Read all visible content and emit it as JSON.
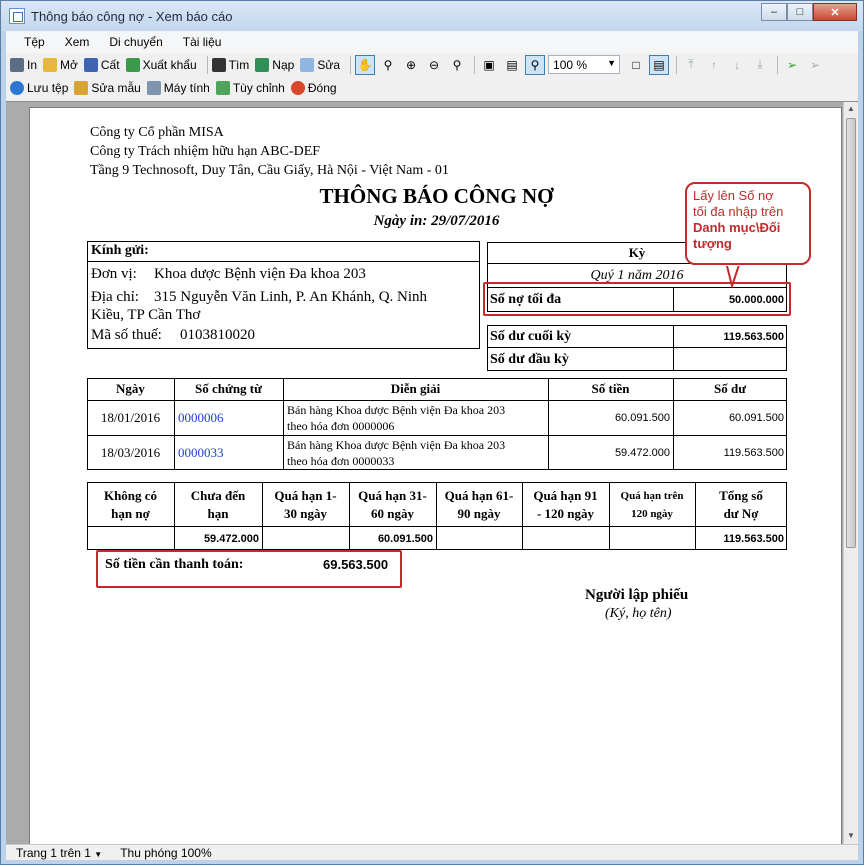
{
  "window": {
    "title": "Thông báo công nợ - Xem báo cáo"
  },
  "menu": [
    "Tệp",
    "Xem",
    "Di chuyển",
    "Tài liệu"
  ],
  "toolbar1": {
    "print": "In",
    "open": "Mở",
    "save": "Cất",
    "export": "Xuất khẩu",
    "find": "Tìm",
    "load": "Nạp",
    "edit": "Sửa",
    "zoom": "100 %"
  },
  "toolbar2": {
    "save_file": "Lưu tệp",
    "edit_template": "Sửa mẫu",
    "calculator": "Máy tính",
    "customize": "Tùy chỉnh",
    "close": "Đóng"
  },
  "status": {
    "page": "Trang 1 trên 1",
    "zoom": "Thu phóng 100%"
  },
  "report": {
    "company1": "Công ty Cổ phần MISA",
    "company2": "Công ty Trách nhiệm hữu hạn ABC-DEF",
    "address": "Tầng 9 Technosoft, Duy Tân, Cầu Giấy, Hà Nội - Việt Nam - 01",
    "title": "THÔNG BÁO CÔNG NỢ",
    "print_date": "Ngày in: 29/07/2016",
    "recipient": {
      "heading": "Kính gửi:",
      "unit_label": "Đơn vị:",
      "unit": "Khoa dược Bệnh viện Đa khoa 203",
      "address_label": "Địa chỉ:",
      "address_line1": "315 Nguyễn Văn Linh, P. An Khánh, Q. Ninh",
      "address_line2": "Kiều, TP Cần Thơ",
      "tax_label": "Mã số thuế:",
      "tax": "0103810020"
    },
    "period": {
      "heading": "Kỳ",
      "value": "Quý 1 năm 2016",
      "max_debt_label": "Số nợ tối đa",
      "max_debt": "50.000.000",
      "closing_label": "Số dư cuối kỳ",
      "closing": "119.563.500",
      "opening_label": "Số dư đầu kỳ",
      "opening": ""
    },
    "detail": {
      "headers": [
        "Ngày",
        "Số chứng từ",
        "Diễn giải",
        "Số tiền",
        "Số dư"
      ],
      "rows": [
        {
          "date": "18/01/2016",
          "doc": "0000006",
          "desc1": "Bán hàng Khoa dược Bệnh viện Đa khoa 203",
          "desc2": "theo hóa đơn 0000006",
          "amount": "60.091.500",
          "balance": "60.091.500"
        },
        {
          "date": "18/03/2016",
          "doc": "0000033",
          "desc1": "Bán hàng Khoa dược Bệnh viện Đa khoa 203",
          "desc2": "theo hóa đơn 0000033",
          "amount": "59.472.000",
          "balance": "119.563.500"
        }
      ]
    },
    "aging": {
      "headers": [
        [
          "Không có",
          "hạn nợ"
        ],
        [
          "Chưa đến",
          "hạn"
        ],
        [
          "Quá hạn 1-",
          "30 ngày"
        ],
        [
          "Quá hạn 31-",
          "60 ngày"
        ],
        [
          "Quá hạn 61-",
          "90 ngày"
        ],
        [
          "Quá hạn 91",
          "- 120 ngày"
        ],
        [
          "Quá hạn trên",
          "120 ngày"
        ],
        [
          "Tổng số",
          "dư Nợ"
        ]
      ],
      "values": [
        "",
        "59.472.000",
        "",
        "60.091.500",
        "",
        "",
        "",
        "119.563.500"
      ]
    },
    "pay_label": "Số tiền cần thanh toán:",
    "pay_value": "69.563.500",
    "signer": "Người lập phiếu",
    "signer_note": "(Ký, họ tên)",
    "callout": {
      "line1": "Lấy lên Số nợ",
      "line2": "tối đa nhập trên",
      "line3": "Danh mục\\Đối",
      "line4": "tượng"
    }
  }
}
